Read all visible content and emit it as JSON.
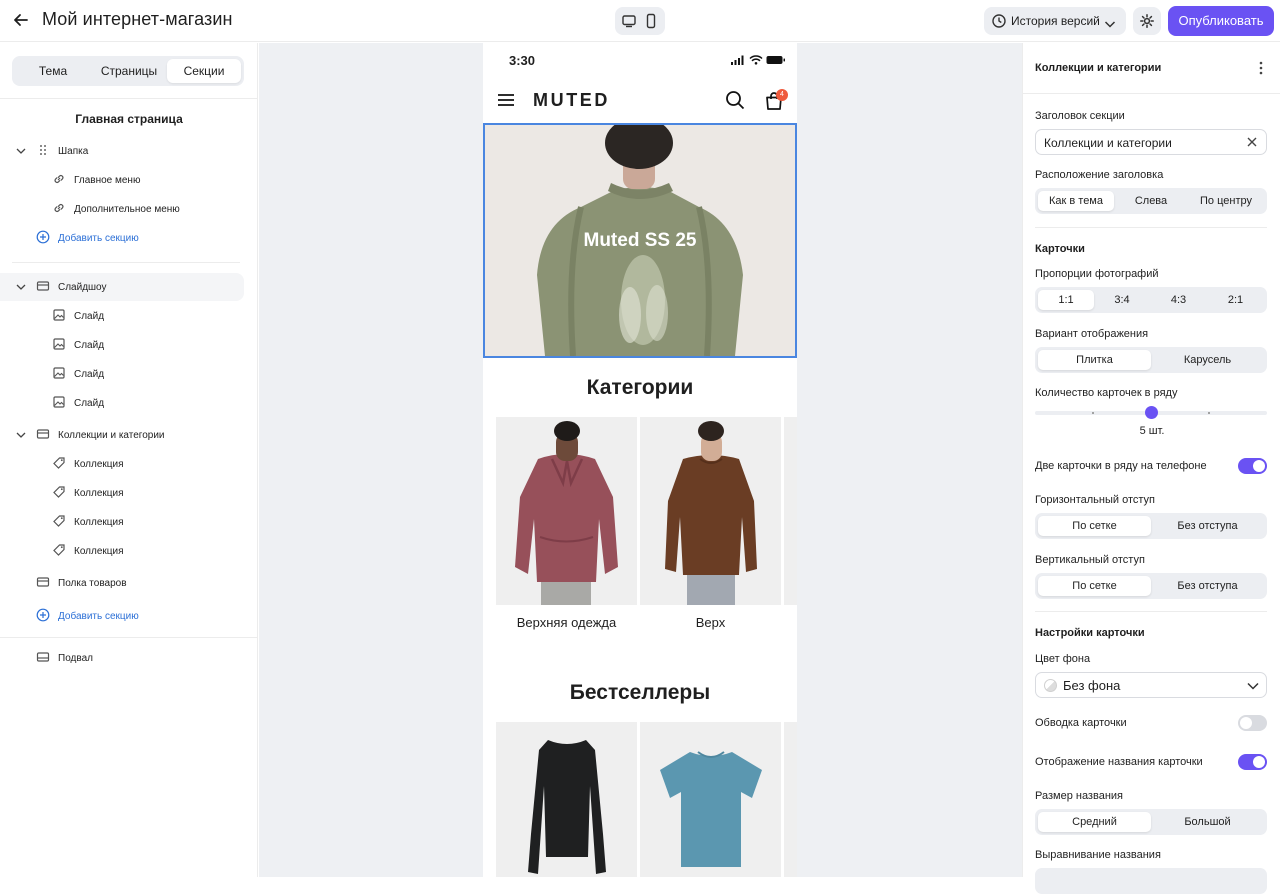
{
  "header": {
    "title": "Мой интернет-магазин",
    "history_label": "История версий",
    "publish_label": "Опубликовать"
  },
  "left_panel": {
    "tabs": [
      {
        "label": "Тема",
        "active": false
      },
      {
        "label": "Страницы",
        "active": false
      },
      {
        "label": "Секции",
        "active": true
      }
    ],
    "page_title": "Главная страница",
    "tree": {
      "header_group": "Шапка",
      "main_menu": "Главное меню",
      "extra_menu": "Дополнительное меню",
      "add_section_1": "Добавить секцию",
      "slideshow": "Слайдшоу",
      "slides": [
        "Слайд",
        "Слайд",
        "Слайд",
        "Слайд"
      ],
      "collections_group": "Коллекции и категории",
      "collections": [
        "Коллекция",
        "Коллекция",
        "Коллекция",
        "Коллекция"
      ],
      "product_shelf": "Полка товаров",
      "add_section_2": "Добавить секцию",
      "footer": "Подвал"
    }
  },
  "preview": {
    "status_time": "3:30",
    "brand": "MUTED",
    "cart_count": "4",
    "hero_text": "Muted SS 25",
    "categories_title": "Категории",
    "categories": [
      {
        "label": "Верхняя одежда"
      },
      {
        "label": "Верх"
      }
    ],
    "bestsellers_title": "Бестселлеры"
  },
  "right_panel": {
    "title": "Коллекции и категории",
    "section_heading_label": "Заголовок секции",
    "section_heading_value": "Коллекции и категории",
    "heading_position_label": "Расположение заголовка",
    "heading_position_options": [
      "Как в тема",
      "Слева",
      "По центру"
    ],
    "heading_position_selected": 0,
    "cards_label": "Карточки",
    "photo_ratio_label": "Пропорции фотографий",
    "photo_ratio_options": [
      "1:1",
      "3:4",
      "4:3",
      "2:1"
    ],
    "photo_ratio_selected": 0,
    "display_variant_label": "Вариант отображения",
    "display_variant_options": [
      "Плитка",
      "Карусель"
    ],
    "display_variant_selected": 0,
    "cards_per_row_label": "Количество карточек в ряду",
    "cards_per_row_value": "5 шт.",
    "cards_per_row": 5,
    "cards_per_row_range": [
      3,
      7
    ],
    "two_cards_phone_label": "Две карточки в ряду на телефоне",
    "two_cards_phone_on": true,
    "h_gap_label": "Горизонтальный отступ",
    "h_gap_options": [
      "По сетке",
      "Без отступа"
    ],
    "h_gap_selected": 0,
    "v_gap_label": "Вертикальный отступ",
    "v_gap_options": [
      "По сетке",
      "Без отступа"
    ],
    "v_gap_selected": 0,
    "card_settings_label": "Настройки карточки",
    "bg_color_label": "Цвет фона",
    "bg_color_value": "Без фона",
    "card_border_label": "Обводка карточки",
    "card_border_on": false,
    "card_name_display_label": "Отображение названия карточки",
    "card_name_display_on": true,
    "name_size_label": "Размер названия",
    "name_size_options": [
      "Средний",
      "Большой"
    ],
    "name_size_selected": 0,
    "name_align_label": "Выравнивание названия"
  },
  "colors": {
    "accent": "#6a52f3",
    "link": "#2b6fd6",
    "selection": "#4a86e0",
    "canvas_bg": "#eef0f3",
    "badge": "#ef5a3c"
  }
}
